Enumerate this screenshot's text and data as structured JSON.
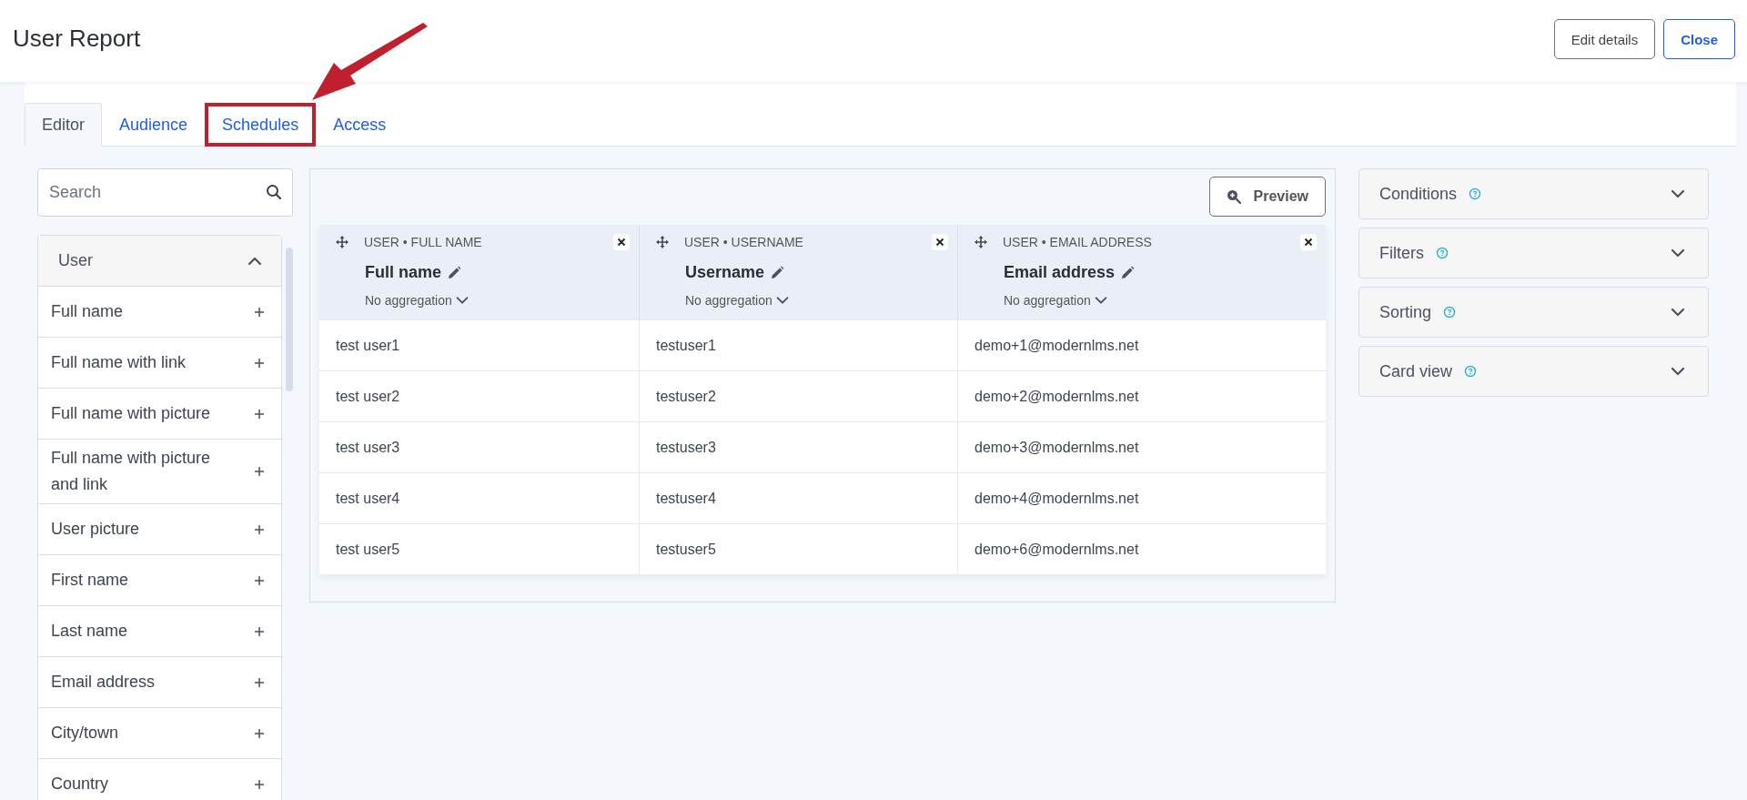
{
  "header": {
    "title": "User Report",
    "buttons": [
      {
        "label": "Edit details",
        "kind": "secondary"
      },
      {
        "label": "Close",
        "kind": "primary"
      }
    ]
  },
  "tabs": [
    {
      "label": "Editor",
      "selected": true,
      "highlighted": false
    },
    {
      "label": "Audience",
      "selected": false,
      "highlighted": false
    },
    {
      "label": "Schedules",
      "selected": false,
      "highlighted": true
    },
    {
      "label": "Access",
      "selected": false,
      "highlighted": false
    }
  ],
  "sidebar": {
    "search": {
      "placeholder": "Search"
    },
    "section": {
      "title": "User",
      "expanded": true,
      "items": [
        "Full name",
        "Full name with link",
        "Full name with picture",
        "Full name with picture and link",
        "User picture",
        "First name",
        "Last name",
        "Email address",
        "City/town",
        "Country"
      ]
    }
  },
  "report": {
    "preview_button": "Preview",
    "columns": [
      {
        "source": "USER • FULL NAME",
        "title": "Full name",
        "aggregation": "No aggregation"
      },
      {
        "source": "USER • USERNAME",
        "title": "Username",
        "aggregation": "No aggregation"
      },
      {
        "source": "USER • EMAIL ADDRESS",
        "title": "Email address",
        "aggregation": "No aggregation"
      }
    ],
    "rows": [
      [
        "test user1",
        "testuser1",
        "demo+1@modernlms.net"
      ],
      [
        "test user2",
        "testuser2",
        "demo+2@modernlms.net"
      ],
      [
        "test user3",
        "testuser3",
        "demo+3@modernlms.net"
      ],
      [
        "test user4",
        "testuser4",
        "demo+4@modernlms.net"
      ],
      [
        "test user5",
        "testuser5",
        "demo+6@modernlms.net"
      ]
    ]
  },
  "panels": [
    {
      "title": "Conditions",
      "expanded": false
    },
    {
      "title": "Filters",
      "expanded": false
    },
    {
      "title": "Sorting",
      "expanded": false
    },
    {
      "title": "Card view",
      "expanded": false
    }
  ]
}
